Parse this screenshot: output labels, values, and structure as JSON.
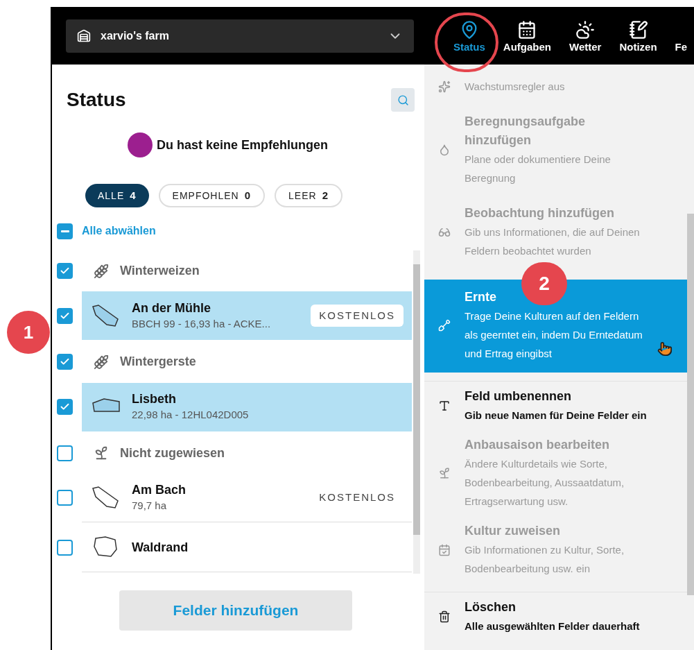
{
  "header": {
    "farm_selector": {
      "label": "xarvio's farm"
    },
    "nav_tabs": [
      {
        "label": "Status",
        "selected": true
      },
      {
        "label": "Aufgaben",
        "selected": false
      },
      {
        "label": "Wetter",
        "selected": false
      },
      {
        "label": "Notizen",
        "selected": false
      },
      {
        "label": "Fe",
        "selected": false
      }
    ]
  },
  "panel": {
    "title": "Status",
    "recommendation": {
      "text": "Du hast keine Empfehlungen",
      "color": "#9c1f8f"
    },
    "filters": [
      {
        "label": "ALLE",
        "count": "4",
        "selected": true
      },
      {
        "label": "EMPFOHLEN",
        "count": "0",
        "selected": false
      },
      {
        "label": "LEER",
        "count": "2",
        "selected": false
      }
    ],
    "select_all": {
      "label": "Alle abwählen",
      "mixed": true
    },
    "list": [
      {
        "kind": "group",
        "label": "Winterweizen",
        "checked": true
      },
      {
        "kind": "field",
        "name": "An der Mühle",
        "details": "BBCH 99 - 16,93 ha - ACKE...",
        "badge": "KOSTENLOS",
        "checked": true,
        "selected": true
      },
      {
        "kind": "group",
        "label": "Wintergerste",
        "checked": true
      },
      {
        "kind": "field",
        "name": "Lisbeth",
        "details": "22,98 ha - 12HL042D005",
        "checked": true,
        "selected": true
      },
      {
        "kind": "group",
        "label": "Nicht zugewiesen",
        "checked": false
      },
      {
        "kind": "field",
        "name": "Am Bach",
        "details": "79,7 ha",
        "badge": "KOSTENLOS",
        "checked": false,
        "selected": false
      },
      {
        "kind": "field",
        "name": "Waldrand",
        "checked": false,
        "selected": false
      }
    ],
    "add_button": "Felder hinzufügen"
  },
  "menu": {
    "items": [
      {
        "description": "Wachstumsregler aus",
        "disabled": true,
        "selected": false
      },
      {
        "title": "Beregnungsaufgabe hinzufügen",
        "description": "Plane oder dokumentiere Deine Beregnung",
        "disabled": true,
        "selected": false
      },
      {
        "title": "Beobachtung hinzufügen",
        "description": "Gib uns Informationen, die auf Deinen Feldern beobachtet wurden",
        "disabled": true,
        "selected": false
      },
      {
        "title": "Ernte",
        "description": "Trage Deine Kulturen auf den Feldern als geerntet ein, indem Du Erntedatum und Ertrag eingibst",
        "disabled": false,
        "selected": true
      },
      {
        "title": "Feld umbenennen",
        "description": "Gib neue Namen für Deine Felder ein",
        "disabled": false,
        "selected": false
      },
      {
        "title": "Anbausaison bearbeiten",
        "description": "Ändere Kulturdetails wie Sorte, Bodenbearbeitung, Aussaatdatum, Ertragserwartung usw.",
        "disabled": true,
        "selected": false
      },
      {
        "title": "Kultur zuweisen",
        "description": "Gib Informationen zu Kultur, Sorte, Bodenbearbeitung usw. ein",
        "disabled": true,
        "selected": false
      },
      {
        "title": "Löschen",
        "description": "Alle ausgewählten Felder dauerhaft",
        "disabled": false,
        "selected": false
      }
    ]
  },
  "callouts": [
    {
      "label": "1"
    },
    {
      "label": "2"
    }
  ]
}
